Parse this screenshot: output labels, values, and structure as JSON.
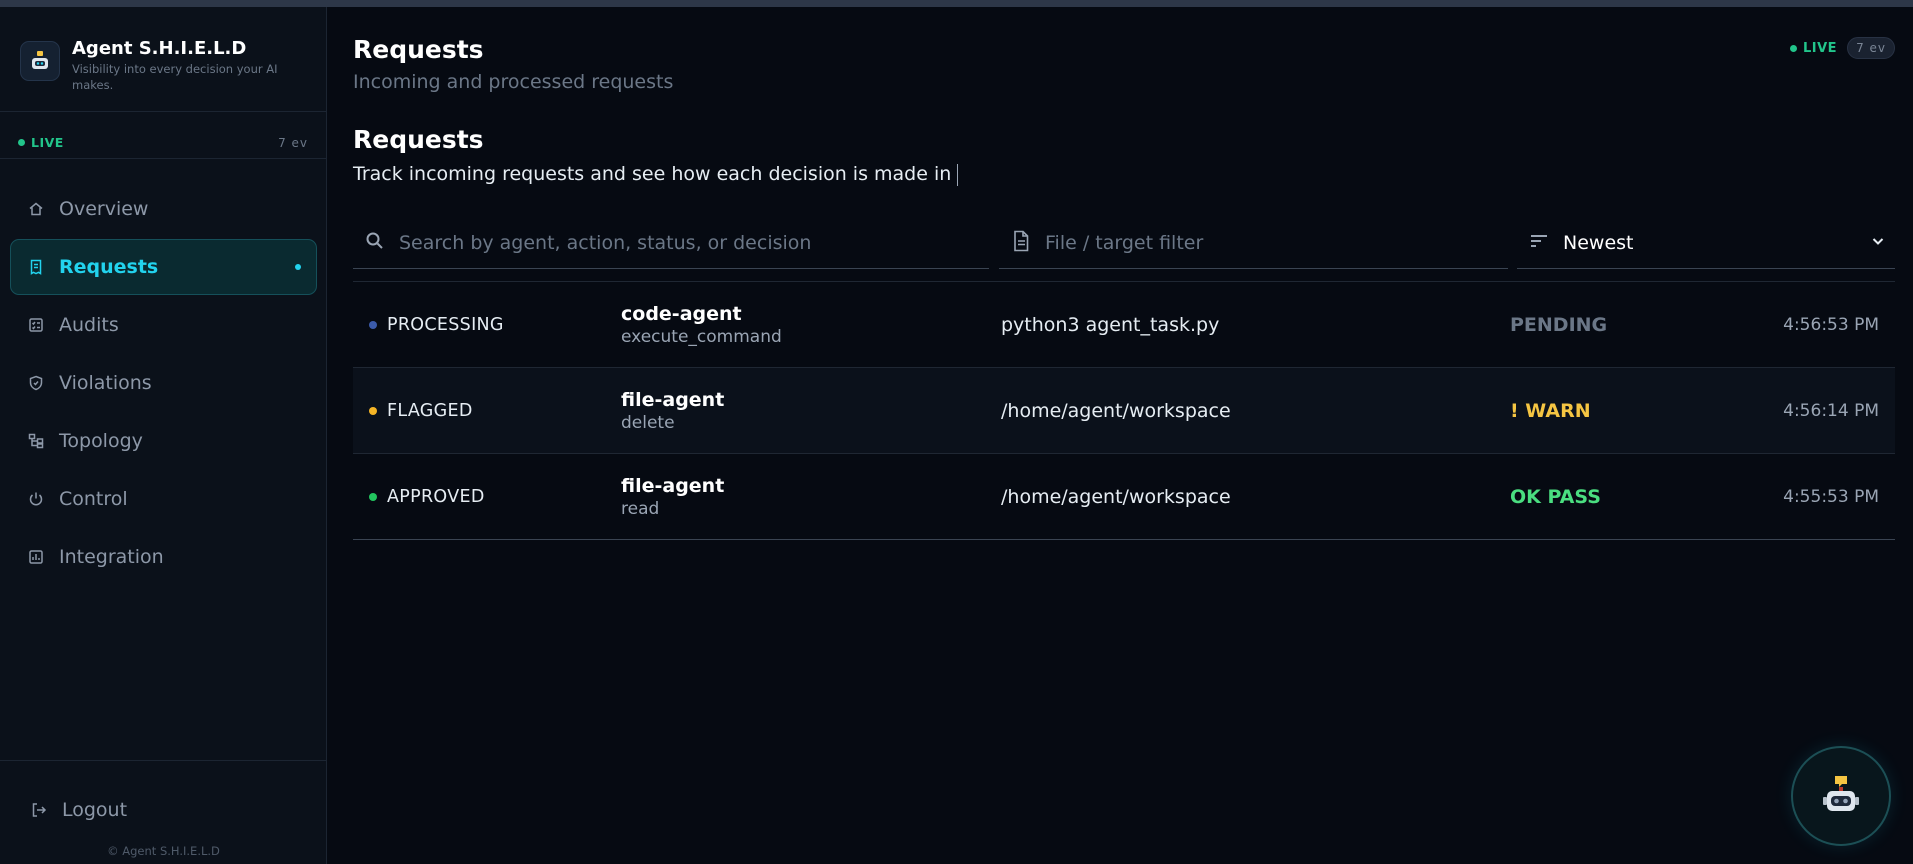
{
  "app": {
    "title": "Agent S.H.I.E.L.D",
    "subtitle": "Visibility into every decision your AI makes.",
    "copyright": "© Agent S.H.I.E.L.D"
  },
  "sidebar": {
    "live_label": "LIVE",
    "event_count": "7 ev",
    "items": [
      {
        "label": "Overview",
        "icon": "home-icon",
        "active": false
      },
      {
        "label": "Requests",
        "icon": "receipt-icon",
        "active": true
      },
      {
        "label": "Audits",
        "icon": "checklist-icon",
        "active": false
      },
      {
        "label": "Violations",
        "icon": "shield-icon",
        "active": false
      },
      {
        "label": "Topology",
        "icon": "network-icon",
        "active": false
      },
      {
        "label": "Control",
        "icon": "power-icon",
        "active": false
      },
      {
        "label": "Integration",
        "icon": "integration-icon",
        "active": false
      }
    ],
    "logout_label": "Logout"
  },
  "header": {
    "title": "Requests",
    "subtitle": "Incoming and processed requests",
    "live_label": "LIVE",
    "event_count": "7 ev"
  },
  "section": {
    "title": "Requests",
    "description": "Track incoming requests and see how each decision is made in"
  },
  "filters": {
    "search_placeholder": "Search by agent, action, status, or decision",
    "file_placeholder": "File / target filter",
    "sort_value": "Newest"
  },
  "requests": [
    {
      "status": "PROCESSING",
      "status_color": "#3b5bab",
      "agent": "code-agent",
      "action": "execute_command",
      "target": "python3 agent_task.py",
      "decision": "PENDING",
      "decision_color": "#6b7787",
      "time": "4:56:53 PM"
    },
    {
      "status": "FLAGGED",
      "status_color": "#f5b526",
      "agent": "file-agent",
      "action": "delete",
      "target": "/home/agent/workspace",
      "decision": "! WARN",
      "decision_color": "#f5c542",
      "time": "4:56:14 PM"
    },
    {
      "status": "APPROVED",
      "status_color": "#22c55e",
      "agent": "file-agent",
      "action": "read",
      "target": "/home/agent/workspace",
      "decision": "OK PASS",
      "decision_color": "#4ade80",
      "time": "4:55:53 PM"
    }
  ],
  "colors": {
    "accent": "#22d3ee",
    "live": "#22c58b",
    "background": "#060a12",
    "sidebar": "#0b111a"
  }
}
